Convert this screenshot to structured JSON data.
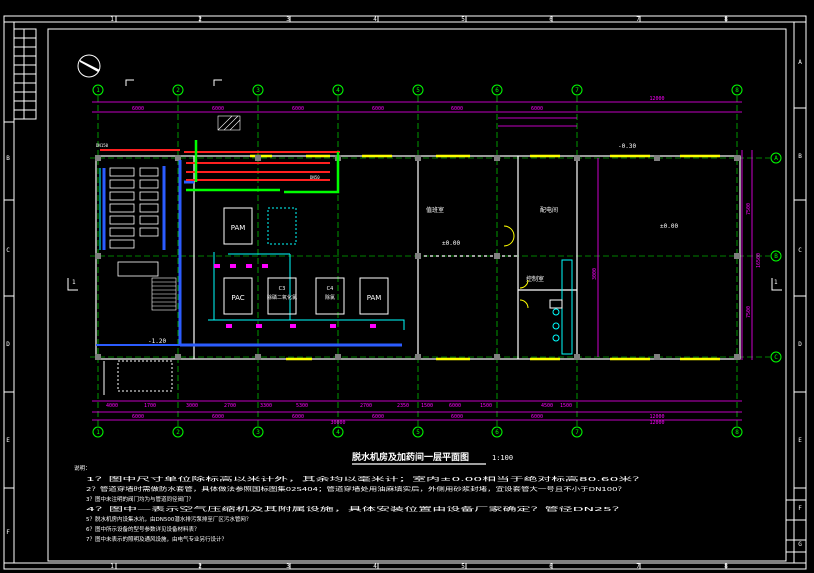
{
  "frame": {
    "top_numbers": [
      "1",
      "2",
      "3",
      "4",
      "5",
      "6",
      "7",
      "8"
    ],
    "bottom_numbers": [
      "1",
      "2",
      "3",
      "4",
      "5",
      "6",
      "7",
      "8"
    ],
    "left_letters": [
      "B",
      "C",
      "D",
      "E",
      "F"
    ],
    "right_letters": [
      "A",
      "B",
      "C",
      "D",
      "E",
      "F",
      "G"
    ]
  },
  "grid": {
    "axes_numbers": [
      "1",
      "2",
      "3",
      "4",
      "5",
      "6",
      "7",
      "8"
    ],
    "axes_letters": [
      "A",
      "B",
      "C"
    ],
    "dims_top": [
      "6000",
      "6000",
      "6000",
      "6000",
      "6000",
      "6000",
      "12000"
    ],
    "dims_bottom_overall": [
      "6000",
      "6000",
      "6000",
      "6000",
      "6000",
      "6000",
      "12000"
    ],
    "dims_bottom_detail": [
      "4000",
      "1700",
      "3000",
      "2700",
      "3300",
      "5300",
      "2700",
      "2350",
      "1500",
      "6000",
      "1500",
      "4500",
      "1500"
    ],
    "total_length": "30000",
    "total_right": "12000",
    "right_dims": [
      "7500",
      "3000",
      "7500",
      "16500"
    ],
    "level_top": "-0.30",
    "level_mid1": "±0.00",
    "level_mid2": "±0.00",
    "level_bottom": "-1.20",
    "section_marks": [
      "1",
      "1"
    ]
  },
  "rooms": {
    "room_a": "值班室",
    "room_b": "配电间",
    "room_c": "控制室",
    "pam1": "PAM",
    "pac": "PAC",
    "pam2": "PAM",
    "tank_c": "C3",
    "tank_c_sub": "除磷二氧化氯",
    "tank_h": "C4",
    "tank_h_sub": "除氯"
  },
  "title": {
    "main": "脱水机房及加药间一层平面图",
    "scale": "1:100"
  },
  "notes": {
    "heading": "说明：",
    "items": [
      "1？图中尺寸单位除标高以米计外，其余均以毫米计；室内±0.00相当于绝对标高80.60米？",
      "2？管道穿墙时需做防水套管，具体做法参照国标图集02S404；管道穿墙处用油麻填实后，外侧用砂浆封堵，宜设套管大一号且不小于DN100？",
      "3？图中未注明的阀门均为与管道同径阀门？",
      "4？图中—表示空气压缩机及其附属设施，具体安装位置由设备厂家确定？管径DN25？",
      "5？脱水机房内设集水坑，由DN500潜水排污泵排至厂区污水管网？",
      "6？图中所示设备的型号参数详见设备材料表？",
      "7？图中未表示的照明及通风设施，由电气专业另行设计？"
    ]
  }
}
